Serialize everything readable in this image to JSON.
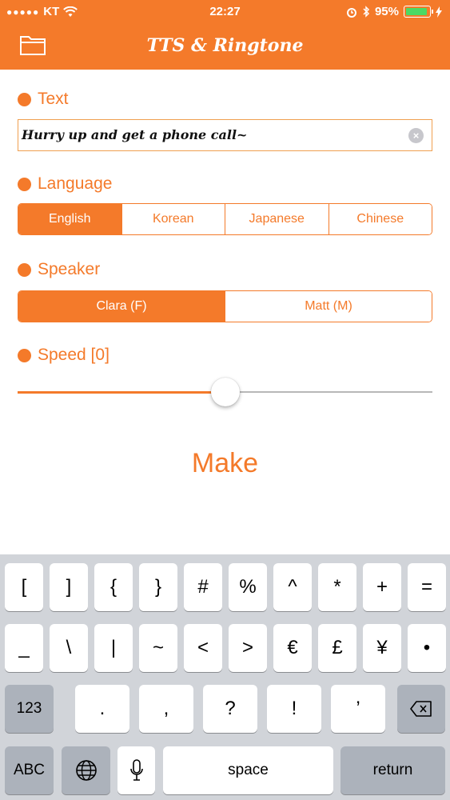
{
  "status": {
    "carrier": "KT",
    "signal_dots": "●●●●●",
    "time": "22:27",
    "battery_percent": "95%",
    "battery_level": 0.95
  },
  "nav": {
    "title": "TTS & Ringtone",
    "folder_icon": "folder-icon"
  },
  "sections": {
    "text_label": "Text",
    "text_value": "Hurry up and get a phone call~",
    "language_label": "Language",
    "speaker_label": "Speaker",
    "speed_label": "Speed [0]"
  },
  "languages": [
    {
      "label": "English",
      "selected": true
    },
    {
      "label": "Korean",
      "selected": false
    },
    {
      "label": "Japanese",
      "selected": false
    },
    {
      "label": "Chinese",
      "selected": false
    }
  ],
  "speakers": [
    {
      "label": "Clara (F)",
      "selected": true
    },
    {
      "label": "Matt (M)",
      "selected": false
    }
  ],
  "speed": {
    "value": 0,
    "fraction": 0.5
  },
  "make_label": "Make",
  "keyboard": {
    "row1": [
      "[",
      "]",
      "{",
      "}",
      "#",
      "%",
      "^",
      "*",
      "+",
      "="
    ],
    "row2": [
      "_",
      "\\",
      "|",
      "~",
      "<",
      ">",
      "€",
      "£",
      "¥",
      "•"
    ],
    "row3_left": "123",
    "row3": [
      ".",
      ",",
      "?",
      "!",
      "’"
    ],
    "abc": "ABC",
    "space": "space",
    "return": "return"
  },
  "colors": {
    "accent": "#f47a2a",
    "battery": "#4cd964"
  }
}
